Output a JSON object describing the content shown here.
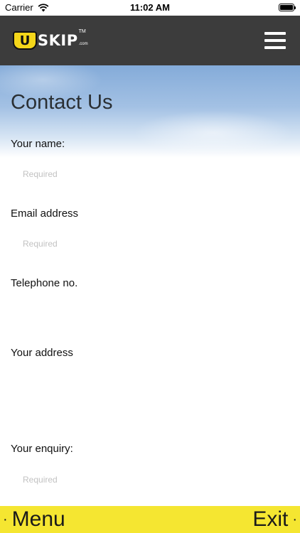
{
  "status": {
    "carrier": "Carrier",
    "time": "11:02 AM",
    "battery_level": 1.0
  },
  "header": {
    "logo_badge": "U",
    "logo_text": "SKIP",
    "logo_tm": "TM",
    "logo_domain": ".com",
    "menu_icon": "hamburger-menu-icon"
  },
  "page": {
    "title": "Contact Us"
  },
  "form": {
    "name_label": "Your name:",
    "name_placeholder": "Required",
    "email_label": "Email address",
    "email_placeholder": "Required",
    "phone_label": "Telephone no.",
    "phone_placeholder": "",
    "address_label": "Your address",
    "address_placeholder": "",
    "enquiry_label": "Your enquiry:",
    "enquiry_placeholder": "Required"
  },
  "bottom": {
    "menu_label": "Menu",
    "exit_label": "Exit",
    "dot": "·"
  },
  "colors": {
    "header_bg": "#3c3c3c",
    "logo_yellow": "#f4d61a",
    "bottom_bar": "#f5e631",
    "sky_blue": "#84abd9"
  }
}
